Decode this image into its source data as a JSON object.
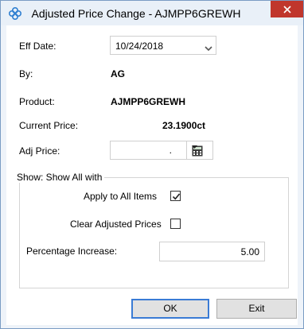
{
  "window": {
    "title": "Adjusted Price Change - AJMPP6GREWH",
    "close_icon": "close-icon",
    "app_icon": "app-logo-icon",
    "accent_color": "#3a7bd5",
    "close_color": "#c0362c"
  },
  "form": {
    "eff_date": {
      "label": "Eff Date:",
      "value": "10/24/2018"
    },
    "by": {
      "label": "By:",
      "value": "AG"
    },
    "product": {
      "label": "Product:",
      "value": "AJMPP6GREWH"
    },
    "current_price": {
      "label": "Current Price:",
      "value": "23.1900ct"
    },
    "adj_price": {
      "label": "Adj Price:",
      "value": "."
    }
  },
  "group": {
    "legend": "Show: Show All with",
    "apply_all": {
      "label": "Apply to All Items",
      "checked": true
    },
    "clear_adjusted": {
      "label": "Clear Adjusted Prices",
      "checked": false
    },
    "percentage": {
      "label": "Percentage Increase:",
      "value": "5.00"
    }
  },
  "buttons": {
    "ok": "OK",
    "exit": "Exit"
  }
}
